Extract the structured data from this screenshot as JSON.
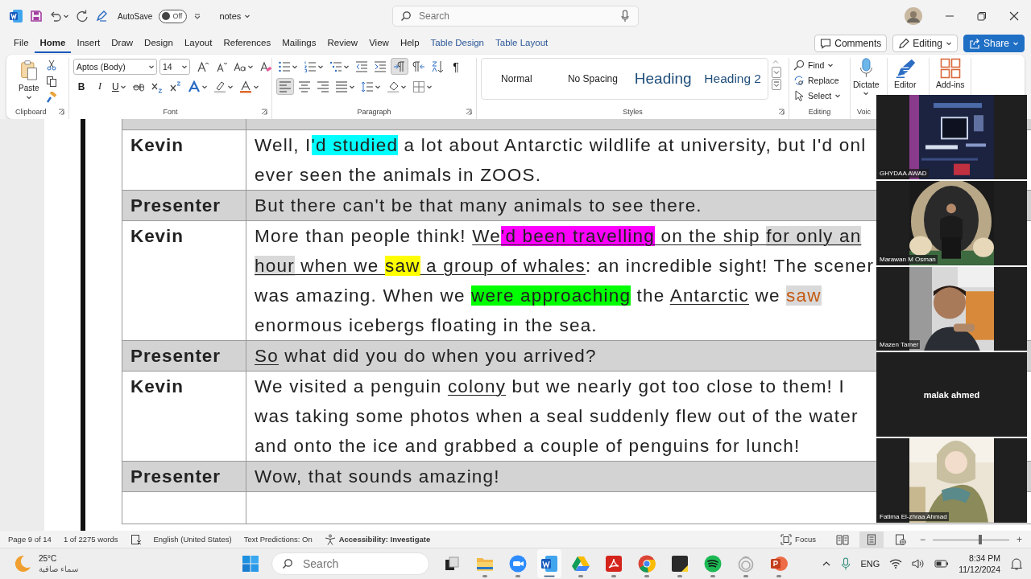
{
  "title_bar": {
    "autosave_label": "AutoSave",
    "autosave": {
      "on": false,
      "label": "Off"
    },
    "document_name": "notes",
    "search": {
      "placeholder": "Search"
    }
  },
  "menu_tabs": [
    {
      "label": "File",
      "selected": false,
      "kind": "plain"
    },
    {
      "label": "Home",
      "selected": true,
      "kind": "plain"
    },
    {
      "label": "Insert",
      "selected": false,
      "kind": "plain"
    },
    {
      "label": "Draw",
      "selected": false,
      "kind": "plain"
    },
    {
      "label": "Design",
      "selected": false,
      "kind": "plain"
    },
    {
      "label": "Layout",
      "selected": false,
      "kind": "plain"
    },
    {
      "label": "References",
      "selected": false,
      "kind": "plain"
    },
    {
      "label": "Mailings",
      "selected": false,
      "kind": "plain"
    },
    {
      "label": "Review",
      "selected": false,
      "kind": "plain"
    },
    {
      "label": "View",
      "selected": false,
      "kind": "plain"
    },
    {
      "label": "Help",
      "selected": false,
      "kind": "plain"
    },
    {
      "label": "Table Design",
      "selected": false,
      "kind": "contextual"
    },
    {
      "label": "Table Layout",
      "selected": false,
      "kind": "contextual"
    }
  ],
  "ribbon_actions": [
    {
      "label": "Comments",
      "kind": "comments"
    },
    {
      "label": "Editing",
      "kind": "editing"
    },
    {
      "label": "Share",
      "kind": "share"
    }
  ],
  "ribbon": {
    "clipboard": {
      "paste": "Paste",
      "label": "Clipboard"
    },
    "font": {
      "font_name": "Aptos (Body)",
      "font_size": "14",
      "label": "Font",
      "row_1": [
        {
          "kind": "grow",
          "dropdown": false
        },
        {
          "kind": "shrink",
          "dropdown": false
        },
        {
          "kind": "case",
          "dropdown": true
        },
        {
          "kind": "clear",
          "dropdown": false
        }
      ],
      "row_2": [
        {
          "kind": "bold",
          "label": "B",
          "dropdown": false
        },
        {
          "kind": "italic",
          "label": "I",
          "dropdown": false
        },
        {
          "kind": "underline",
          "label": "U",
          "dropdown": true
        },
        {
          "kind": "strike",
          "dropdown": false
        },
        {
          "kind": "subscript",
          "dropdown": false
        },
        {
          "kind": "superscript",
          "dropdown": false
        },
        {
          "kind": "effects",
          "dropdown": true
        },
        {
          "kind": "highlight",
          "dropdown": true
        },
        {
          "kind": "fontcolor",
          "dropdown": true
        }
      ]
    },
    "paragraph": {
      "label": "Paragraph",
      "row_1": [
        {
          "kind": "bullets",
          "dropdown": true,
          "selected": false
        },
        {
          "kind": "numbering",
          "dropdown": true,
          "selected": false
        },
        {
          "kind": "multilevel",
          "dropdown": true,
          "selected": false
        },
        {
          "kind": "outdent",
          "dropdown": false,
          "selected": false
        },
        {
          "kind": "indent",
          "dropdown": false,
          "selected": false
        },
        {
          "kind": "ltr",
          "dropdown": false,
          "selected": true
        },
        {
          "kind": "rtl",
          "dropdown": false,
          "selected": false
        },
        {
          "kind": "sort",
          "dropdown": false,
          "selected": false
        },
        {
          "kind": "pilcrow",
          "label": "¶",
          "dropdown": false,
          "selected": false
        }
      ],
      "row_2": [
        {
          "kind": "align-left",
          "dropdown": false,
          "selected": true
        },
        {
          "kind": "align-center",
          "dropdown": false,
          "selected": false
        },
        {
          "kind": "align-right",
          "dropdown": false,
          "selected": false
        },
        {
          "kind": "justify",
          "dropdown": true,
          "selected": false
        },
        {
          "kind": "line-spacing",
          "dropdown": true,
          "selected": false
        },
        {
          "kind": "shading",
          "dropdown": true,
          "selected": false
        },
        {
          "kind": "borders",
          "dropdown": true,
          "selected": false
        }
      ]
    },
    "styles": {
      "label": "Styles",
      "items": [
        {
          "label": "Normal",
          "kind": "body"
        },
        {
          "label": "No Spacing",
          "kind": "body"
        },
        {
          "label": "Heading",
          "kind": "heading1"
        },
        {
          "label": "Heading 2",
          "kind": "heading2"
        }
      ]
    },
    "editing": {
      "label": "Editing",
      "items": [
        {
          "label": "Find",
          "kind": "find",
          "dropdown": true
        },
        {
          "label": "Replace",
          "kind": "replace",
          "dropdown": false
        },
        {
          "label": "Select",
          "kind": "select",
          "dropdown": true
        }
      ]
    },
    "voice": {
      "label": "Voic"
    },
    "big_buttons": [
      {
        "label": "Dictate",
        "kind": "dictate",
        "dropdown": true
      },
      {
        "label": "Editor",
        "kind": "editor",
        "dropdown": false
      },
      {
        "label": "Add-ins",
        "kind": "addins",
        "dropdown": false
      }
    ]
  },
  "document": {
    "rows": [
      {
        "speaker": "Kevin",
        "shaded": false,
        "lines": [
          [
            {
              "text": "Well, I"
            },
            {
              "text": "'d studied",
              "kind": "highlight",
              "color": "#00ffff"
            },
            {
              "text": " a lot about Antarctic wildlife at university, but I'd onl"
            }
          ],
          [
            {
              "text": "ever seen the animals in ZOOS."
            }
          ]
        ]
      },
      {
        "speaker": "Presenter",
        "shaded": true,
        "lines": [
          [
            {
              "text": "But there can't be that many animals to see there."
            }
          ]
        ]
      },
      {
        "speaker": "Kevin",
        "shaded": false,
        "lines": [
          [
            {
              "text": "More than people think! "
            },
            {
              "text": "We",
              "underline": true
            },
            {
              "text": "'d been travelling",
              "underline": true,
              "kind": "highlight",
              "color": "#ff00ff"
            },
            {
              "text": " on the ship ",
              "underline": true
            },
            {
              "text": "for only an",
              "underline": true,
              "kind": "highlight",
              "color": "#d9d9d9"
            }
          ],
          [
            {
              "text": "hour",
              "underline": true,
              "kind": "highlight",
              "color": "#d9d9d9"
            },
            {
              "text": " when we ",
              "underline": true
            },
            {
              "text": "saw",
              "kind": "highlight",
              "color": "#ffff00"
            },
            {
              "text": " a group of whales",
              "underline": true
            },
            {
              "text": ": an incredible sight! The scener"
            }
          ],
          [
            {
              "text": "was amazing. When we "
            },
            {
              "text": "were approaching",
              "kind": "highlight",
              "color": "#00ff00"
            },
            {
              "text": " the "
            },
            {
              "text": "Antarctic",
              "underline": true
            },
            {
              "text": " we "
            },
            {
              "text": "saw",
              "kind": "tracked"
            }
          ],
          [
            {
              "text": "enormous icebergs floating in the sea."
            }
          ]
        ]
      },
      {
        "speaker": "Presenter",
        "shaded": true,
        "lines": [
          [
            {
              "text": "So",
              "underline": true
            },
            {
              "text": " what did you do when you arrived?"
            }
          ]
        ]
      },
      {
        "speaker": "Kevin",
        "shaded": false,
        "lines": [
          [
            {
              "text": "We visited a penguin "
            },
            {
              "text": "colony",
              "underline": true
            },
            {
              "text": " but we nearly got too close to them! I"
            }
          ],
          [
            {
              "text": "was taking some photos when a seal suddenly flew out of the water"
            }
          ],
          [
            {
              "text": "and onto the ice and grabbed a couple of penguins for lunch!"
            }
          ]
        ]
      },
      {
        "speaker": "Presenter",
        "shaded": true,
        "lines": [
          [
            {
              "text": "Wow, that sounds amazing!"
            }
          ]
        ]
      }
    ]
  },
  "participants": [
    {
      "name": "GHYDAA AWAD",
      "video": true
    },
    {
      "name": "Marawan M Osman",
      "video": true
    },
    {
      "name": "Mazen Tamer",
      "video": true
    },
    {
      "name": "malak ahmed",
      "video": false
    },
    {
      "name": "Fatima El-zhraa Ahmad",
      "video": true
    }
  ],
  "status_bar": {
    "page": "Page 9 of 14",
    "words": "1 of 2275 words",
    "language": "English (United States)",
    "text_predictions": "Text Predictions: On",
    "accessibility": "Accessibility: Investigate",
    "focus": "Focus",
    "views": [
      {
        "kind": "read",
        "selected": false
      },
      {
        "kind": "print",
        "selected": true
      },
      {
        "kind": "web",
        "selected": false
      }
    ],
    "zoom": {
      "zoom_out": "−",
      "zoom_in": "+",
      "level": 0.62
    }
  },
  "taskbar": {
    "weather": {
      "temperature": "25°C",
      "condition": "سماء صافية"
    },
    "search": {
      "placeholder": "Search"
    },
    "apps": [
      {
        "kind": "taskview",
        "running": false,
        "active": false
      },
      {
        "kind": "explorer",
        "running": true,
        "active": false
      },
      {
        "kind": "zoom",
        "running": true,
        "active": false
      },
      {
        "kind": "word",
        "running": true,
        "active": true
      },
      {
        "kind": "drive",
        "running": true,
        "active": false
      },
      {
        "kind": "acrobat",
        "running": true,
        "active": false
      },
      {
        "kind": "chrome",
        "running": true,
        "active": false
      },
      {
        "kind": "sticky",
        "running": true,
        "active": false
      },
      {
        "kind": "spotify",
        "running": true,
        "active": false
      },
      {
        "kind": "ring",
        "running": true,
        "active": false
      },
      {
        "kind": "powerpoint",
        "running": true,
        "active": false
      }
    ],
    "tray": {
      "language": "ENG",
      "time": "8:34 PM",
      "date": "11/12/2024"
    }
  }
}
